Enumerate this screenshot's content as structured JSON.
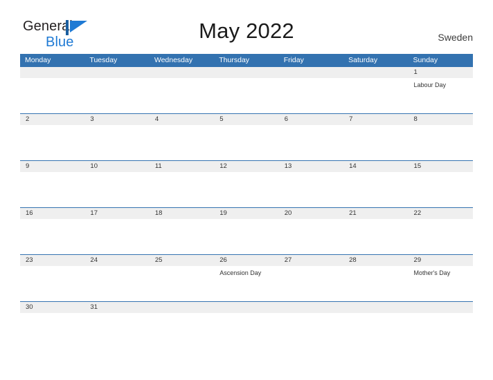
{
  "brand": {
    "name_part1": "General",
    "name_part2": "Blue",
    "flag_icon": "blue-flag-triangle-icon",
    "color_dark": "#231f20",
    "color_blue": "#1f7ad4"
  },
  "header": {
    "title": "May 2022",
    "country": "Sweden"
  },
  "theme": {
    "header_blue": "#3372b0",
    "date_band_gray": "#efefef",
    "text_dark": "#333333",
    "page_background": "#ffffff"
  },
  "calendar": {
    "weekdays": [
      "Monday",
      "Tuesday",
      "Wednesday",
      "Thursday",
      "Friday",
      "Saturday",
      "Sunday"
    ],
    "weeks": [
      {
        "dates": [
          "",
          "",
          "",
          "",
          "",
          "",
          "1"
        ],
        "events": [
          "",
          "",
          "",
          "",
          "",
          "",
          "Labour Day"
        ]
      },
      {
        "dates": [
          "2",
          "3",
          "4",
          "5",
          "6",
          "7",
          "8"
        ],
        "events": [
          "",
          "",
          "",
          "",
          "",
          "",
          ""
        ]
      },
      {
        "dates": [
          "9",
          "10",
          "11",
          "12",
          "13",
          "14",
          "15"
        ],
        "events": [
          "",
          "",
          "",
          "",
          "",
          "",
          ""
        ]
      },
      {
        "dates": [
          "16",
          "17",
          "18",
          "19",
          "20",
          "21",
          "22"
        ],
        "events": [
          "",
          "",
          "",
          "",
          "",
          "",
          ""
        ]
      },
      {
        "dates": [
          "23",
          "24",
          "25",
          "26",
          "27",
          "28",
          "29"
        ],
        "events": [
          "",
          "",
          "",
          "Ascension Day",
          "",
          "",
          "Mother's Day"
        ]
      },
      {
        "dates": [
          "30",
          "31",
          "",
          "",
          "",
          "",
          ""
        ],
        "events": [
          "",
          "",
          "",
          "",
          "",
          "",
          ""
        ]
      }
    ]
  }
}
